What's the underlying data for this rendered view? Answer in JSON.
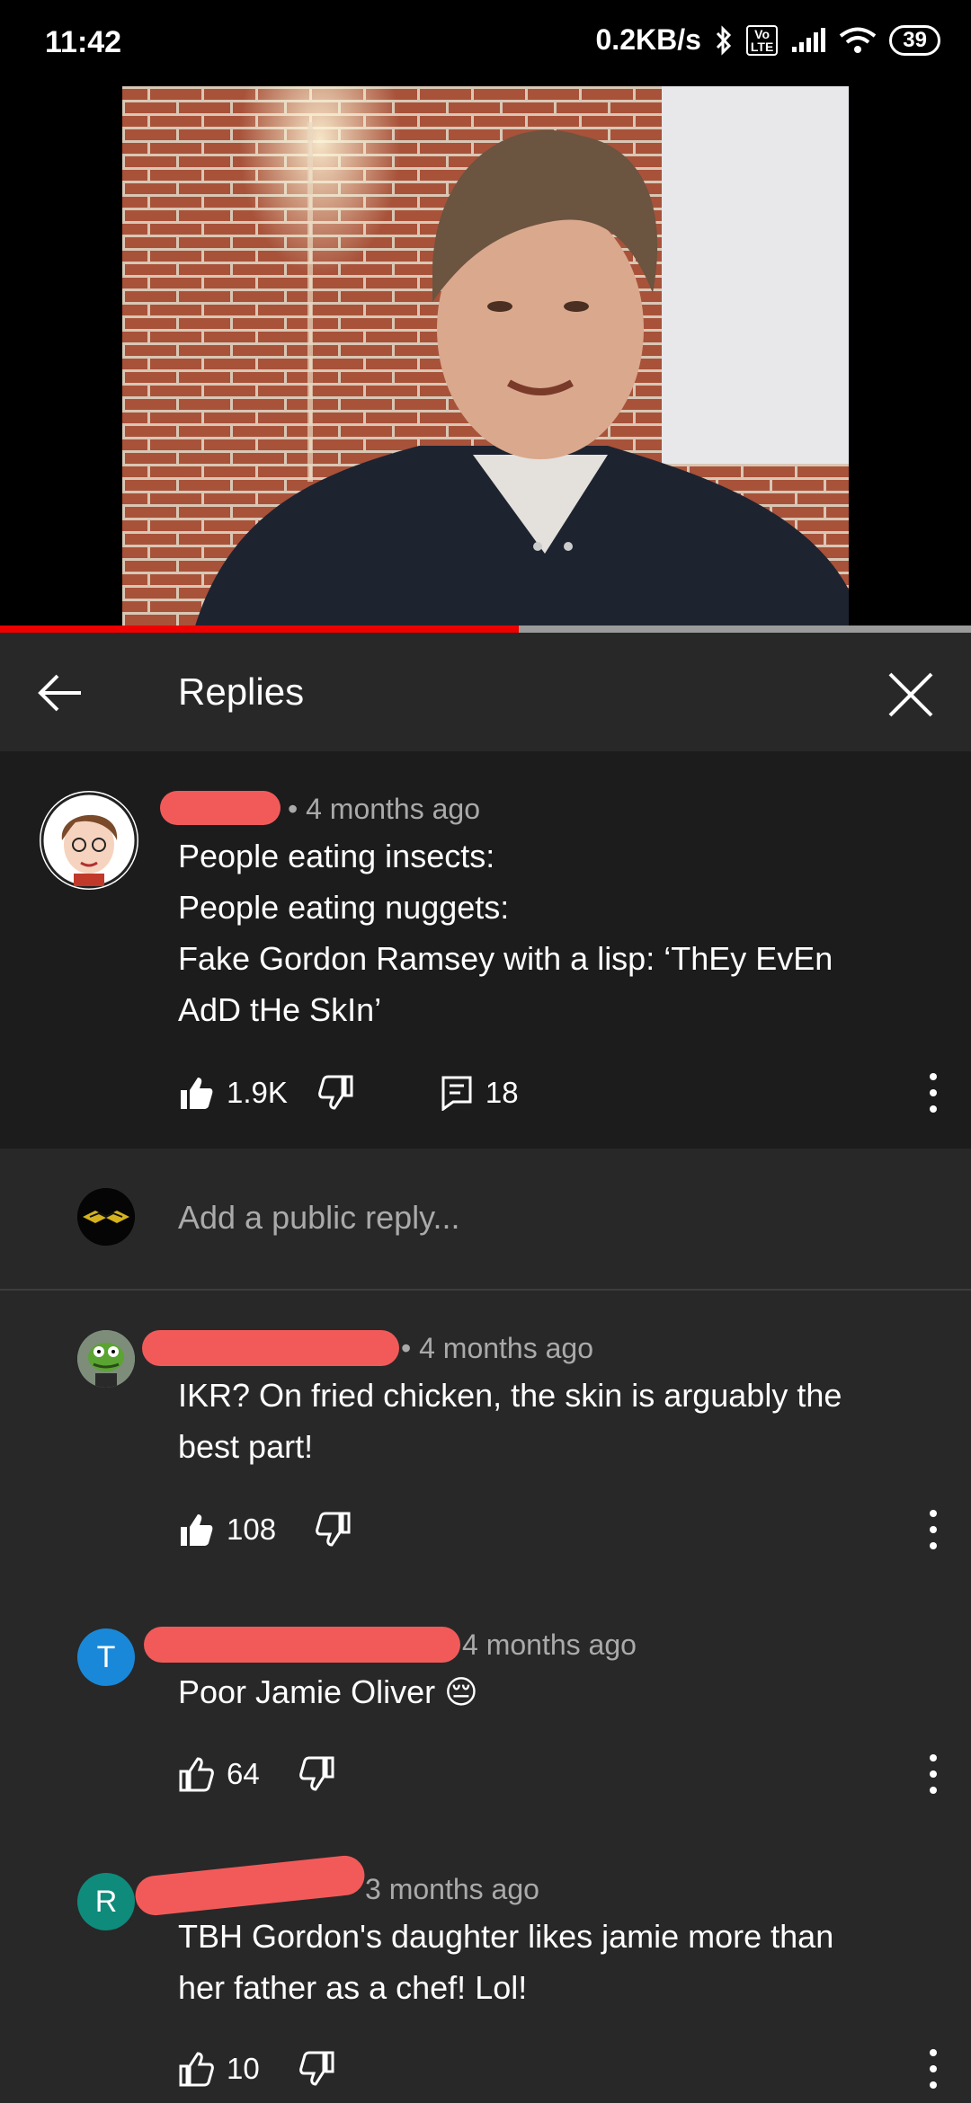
{
  "status_bar": {
    "time": "11:42",
    "speed": "0.2KB/s",
    "volte": "Vo LTE",
    "battery": "39"
  },
  "video": {
    "progress": 0.534
  },
  "header": {
    "title": "Replies"
  },
  "original_comment": {
    "time": "4 months ago",
    "lines": [
      "People eating insects:",
      "People eating nuggets:",
      "Fake Gordon Ramsey with a lisp: ‘ThEy EvEn",
      "AdD tHe SkIn’"
    ],
    "likes": "1.9K",
    "replies": "18"
  },
  "reply_box": {
    "placeholder": "Add a public reply..."
  },
  "replies": [
    {
      "initial": "",
      "time": "4 months ago",
      "lines": [
        "IKR? On fried chicken, the skin is arguably the",
        "best part!"
      ],
      "likes": "108"
    },
    {
      "initial": "T",
      "time": "4 months ago",
      "lines": [
        "Poor Jamie Oliver 😔"
      ],
      "likes": "64"
    },
    {
      "initial": "R",
      "time": "3 months ago",
      "lines": [
        "TBH Gordon's daughter likes jamie more than",
        "her father as a chef! Lol!"
      ],
      "likes": "10"
    }
  ],
  "colors": {
    "accent_red": "#e00000",
    "avatar_t": "#1a88d9",
    "avatar_r": "#0e8b7b",
    "redaction": "#f25a5a"
  }
}
